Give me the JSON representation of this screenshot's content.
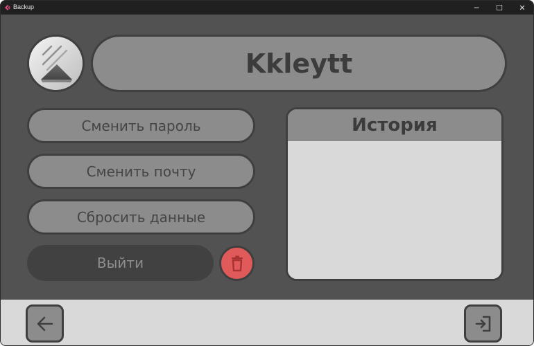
{
  "window": {
    "title": "Backup",
    "controls": {
      "minimize": "─",
      "maximize": "☐",
      "close": "✕"
    }
  },
  "profile": {
    "username": "Kkleytt",
    "avatar_icon": "image-placeholder-icon"
  },
  "actions": {
    "change_password": "Сменить пароль",
    "change_email": "Сменить почту",
    "reset_data": "Сбросить данные",
    "logout": "Выйти",
    "delete_icon": "trash-icon"
  },
  "history": {
    "title": "История",
    "items": []
  },
  "nav": {
    "back_icon": "arrow-left-icon",
    "exit_icon": "sign-in-icon"
  },
  "colors": {
    "background": "#525252",
    "button": "#8c8c8c",
    "border": "#3f3f3f",
    "panel": "#d9d9d9",
    "logout": "#414141",
    "danger": "#e05a5a",
    "titlebar": "#202020"
  }
}
